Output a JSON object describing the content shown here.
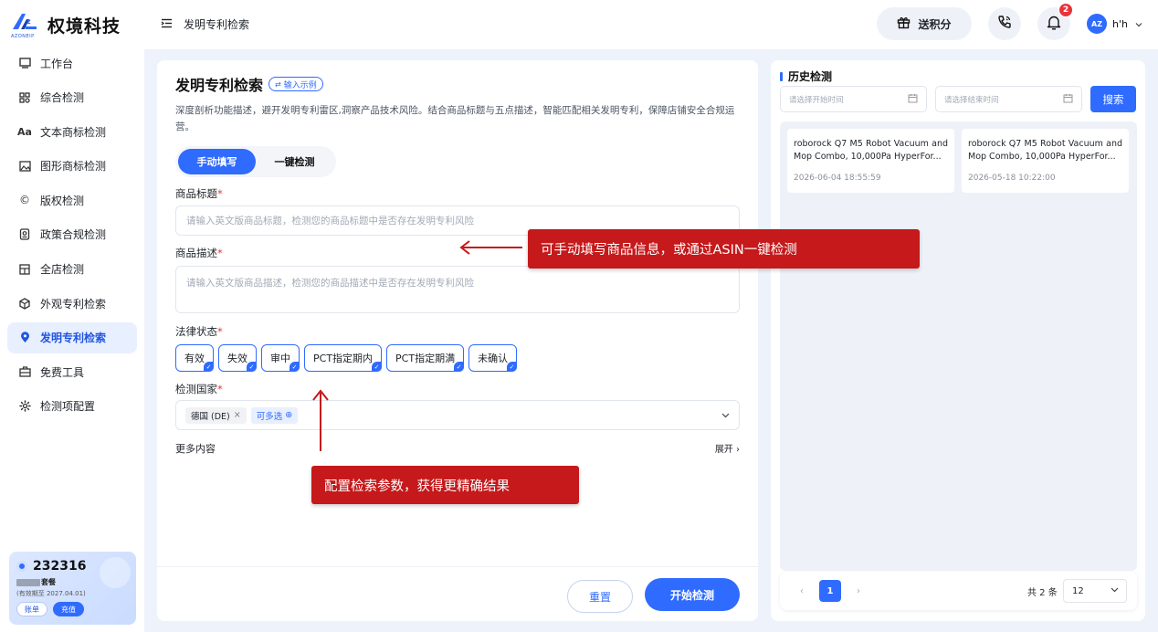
{
  "brand": {
    "name": "权境科技",
    "sub": "AZONEIP"
  },
  "sidebar": {
    "items": [
      {
        "label": "工作台",
        "icon": "monitor-icon"
      },
      {
        "label": "综合检测",
        "icon": "grid-icon"
      },
      {
        "label": "文本商标检测",
        "icon": "text-icon"
      },
      {
        "label": "图形商标检测",
        "icon": "image-icon"
      },
      {
        "label": "版权检测",
        "icon": "copyright-icon"
      },
      {
        "label": "政策合规检测",
        "icon": "policy-icon"
      },
      {
        "label": "全店检测",
        "icon": "store-icon"
      },
      {
        "label": "外观专利检索",
        "icon": "cube-icon"
      },
      {
        "label": "发明专利检索",
        "icon": "pin-icon",
        "active": true
      },
      {
        "label": "免费工具",
        "icon": "toolbox-icon"
      },
      {
        "label": "检测项配置",
        "icon": "settings-icon"
      }
    ]
  },
  "account": {
    "id": "232316",
    "plan": "套餐",
    "expiry": "(有效期至 2027.04.01)",
    "bill_label": "账单",
    "recharge_label": "充值"
  },
  "header": {
    "page_title": "发明专利检索",
    "points_label": "送积分",
    "notification_count": "2",
    "username": "h'h",
    "avatar_text": "AZ"
  },
  "form": {
    "title": "发明专利检索",
    "example_label": "输入示例",
    "description": "深度剖析功能描述，避开发明专利雷区,洞察产品技术风险。结合商品标题与五点描述，智能匹配相关发明专利，保障店铺安全合规运营。",
    "tabs": [
      "手动填写",
      "一键检测"
    ],
    "title_label": "商品标题",
    "title_placeholder": "请输入英文版商品标题，检测您的商品标题中是否存在发明专利风险",
    "desc_label": "商品描述",
    "desc_placeholder": "请输入英文版商品描述，检测您的商品描述中是否存在发明专利风险",
    "legal_label": "法律状态",
    "legal_options": [
      "有效",
      "失效",
      "审中",
      "PCT指定期内",
      "PCT指定期满",
      "未确认"
    ],
    "country_label": "检测国家",
    "country_selected": "德国 (DE)",
    "country_more": "可多选",
    "more_label": "更多内容",
    "expand_label": "展开",
    "reset_label": "重置",
    "start_label": "开始检测",
    "required_mark": "*"
  },
  "annotations": {
    "callout_1": "可手动填写商品信息，或通过ASIN一键检测",
    "callout_2": "配置检索参数，获得更精确结果",
    "color": "#c5191b"
  },
  "history": {
    "title": "历史检测",
    "start_placeholder": "请选择开始时间",
    "end_placeholder": "请选择结束时间",
    "search_label": "搜索",
    "records": [
      {
        "title": "roborock Q7 M5 Robot Vacuum and Mop Combo, 10,000Pa HyperFor...",
        "date": "2026-06-04 18:55:59"
      },
      {
        "title": "roborock Q7 M5 Robot Vacuum and Mop Combo, 10,000Pa HyperFor...",
        "date": "2026-05-18 10:22:00"
      }
    ],
    "page": "1",
    "total_label": "共 2 条",
    "page_size": "12"
  },
  "colors": {
    "accent": "#2f6bff",
    "active_bg": "#e8efff",
    "content_bg": "#eef3fb"
  }
}
